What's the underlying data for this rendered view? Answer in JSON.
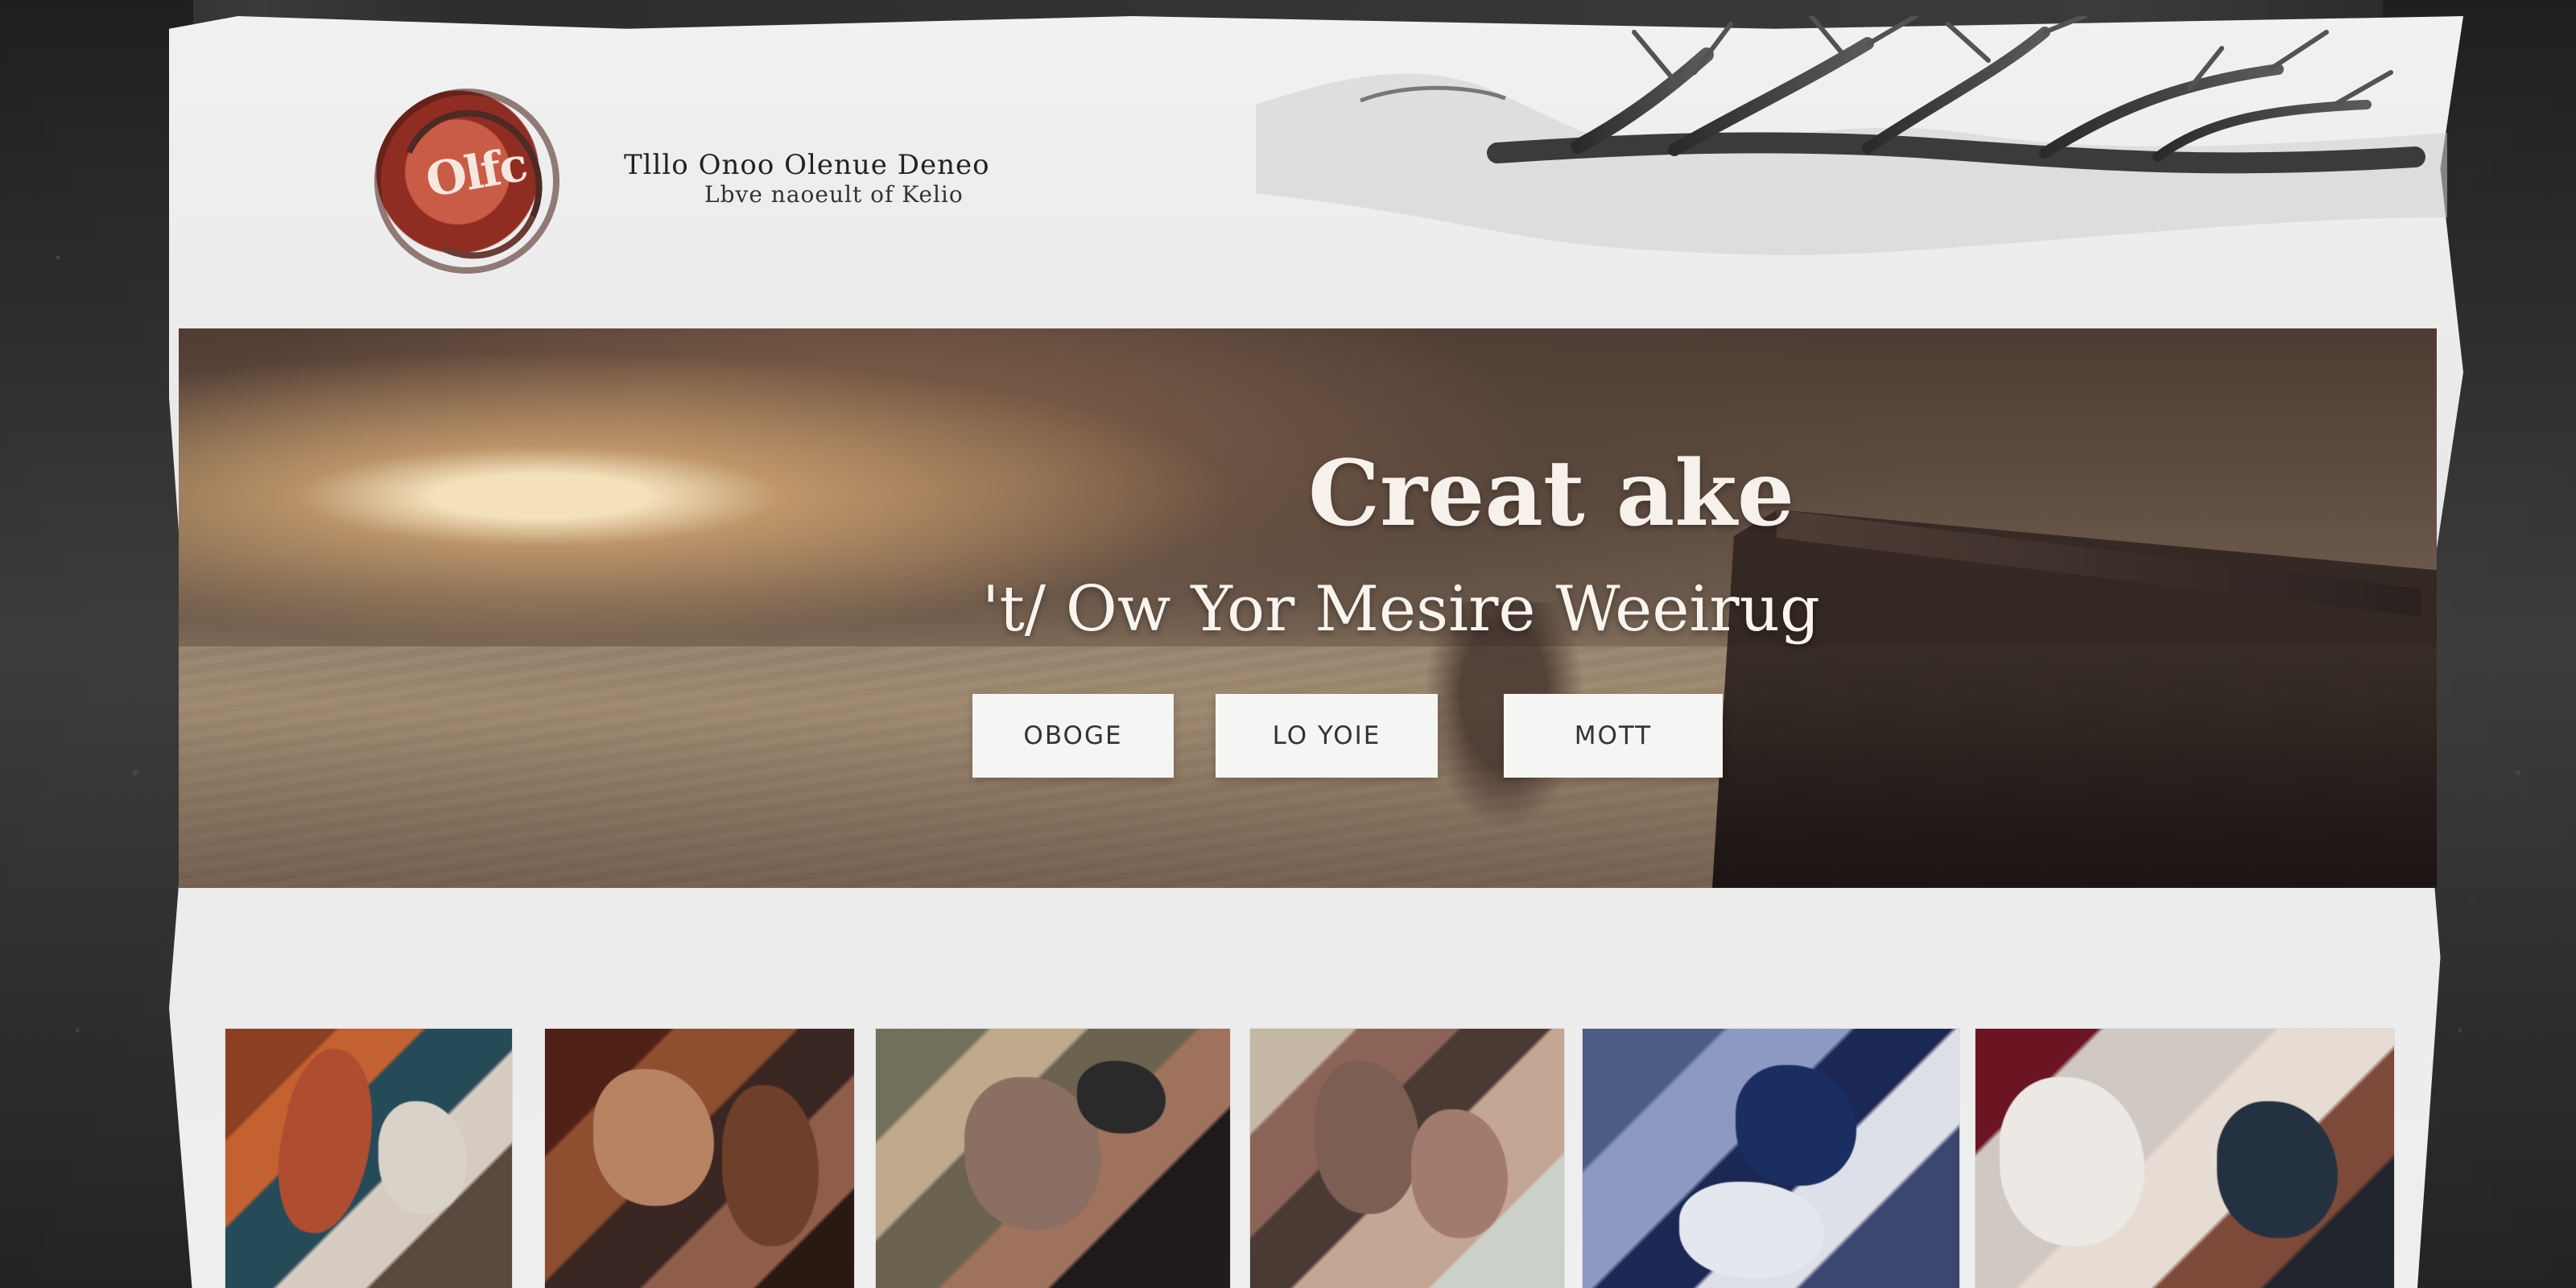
{
  "header": {
    "logo_text": "Olfc",
    "brand_title": "Tlllo Onoo Olenue Deneo",
    "brand_subtitle": "Lbve naoeult of Kelio"
  },
  "hero": {
    "title": "Creat ake",
    "subtitle": "'t/ Ow Yor Mesire Weeirug",
    "buttons": [
      "OBOGE",
      "LO YOIE",
      "MOTT"
    ]
  },
  "gallery": {
    "items": [
      "collage-image",
      "collage-image",
      "collage-image",
      "collage-image",
      "collage-image",
      "collage-image"
    ]
  },
  "colors": {
    "paper": "#efefef",
    "frame": "#2b2b2b",
    "hero_text": "#f6f1eb",
    "button_bg": "#f5f5f3",
    "logo_red": "#b34432"
  }
}
